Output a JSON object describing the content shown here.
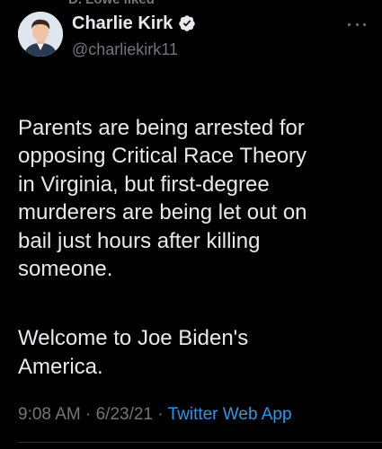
{
  "social_context": "D. Lowe liked",
  "author": {
    "display_name": "Charlie Kirk",
    "handle": "@charliekirk11",
    "verified": true,
    "verified_color": "#1d9bf0"
  },
  "tweet": {
    "paragraphs": [
      "Parents are being arrested for\nopposing Critical Race Theory\nin Virginia, but first-degree\nmurderers are being let out on\nbail just hours after killing\nsomeone.",
      "Welcome to Joe Biden's\nAmerica."
    ]
  },
  "meta": {
    "time": "9:08 AM",
    "separator": "·",
    "date": "6/23/21",
    "source": "Twitter Web App"
  },
  "colors": {
    "background": "#000000",
    "text": "#e7e9ea",
    "secondary": "#71767b",
    "link": "#1d9bf0"
  },
  "icons": {
    "verified": "verified-badge-icon",
    "more": "more-options-icon"
  }
}
